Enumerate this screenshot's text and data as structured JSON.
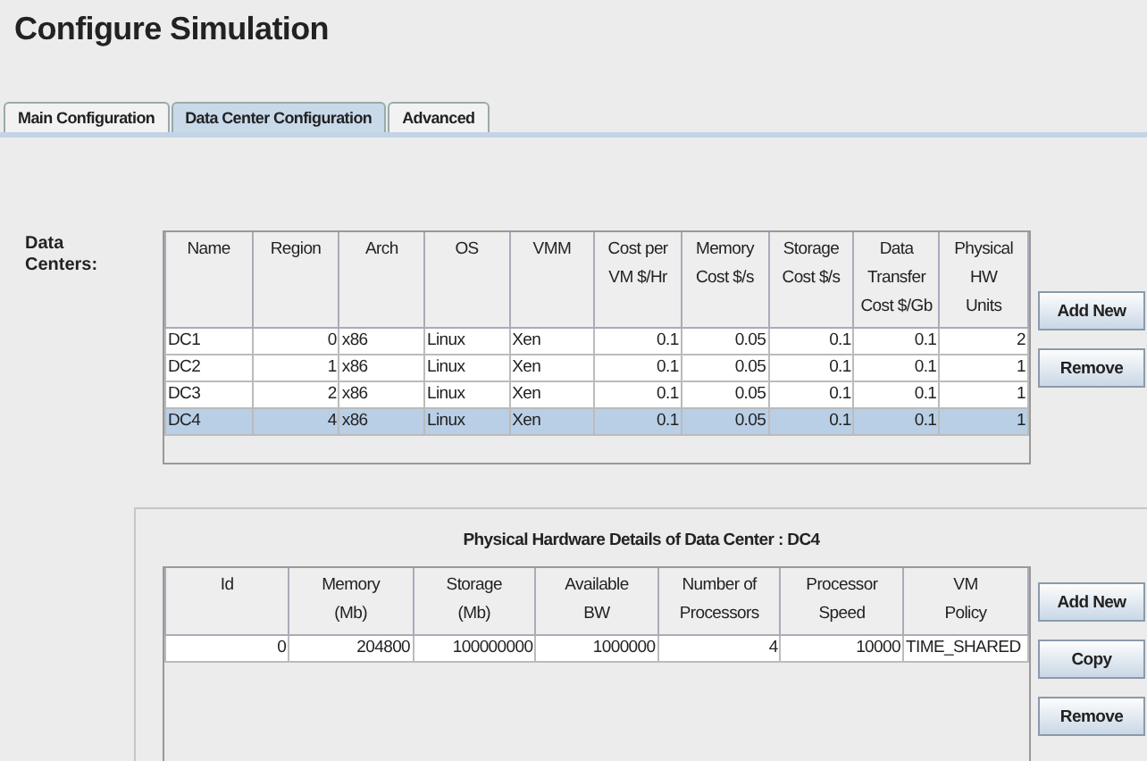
{
  "title": "Configure Simulation",
  "tabs": [
    {
      "label": "Main Configuration",
      "selected": false
    },
    {
      "label": "Data Center Configuration",
      "selected": true
    },
    {
      "label": "Advanced",
      "selected": false
    }
  ],
  "data_centers": {
    "label": "Data\nCenters:",
    "columns": [
      "Name",
      "Region",
      "Arch",
      "OS",
      "VMM",
      "Cost per\nVM $/Hr",
      "Memory\nCost $/s",
      "Storage\nCost $/s",
      "Data\nTransfer\nCost $/Gb",
      "Physical\nHW\nUnits"
    ],
    "rows": [
      {
        "cells": [
          "DC1",
          "0",
          "x86",
          "Linux",
          "Xen",
          "0.1",
          "0.05",
          "0.1",
          "0.1",
          "2"
        ],
        "selected": false
      },
      {
        "cells": [
          "DC2",
          "1",
          "x86",
          "Linux",
          "Xen",
          "0.1",
          "0.05",
          "0.1",
          "0.1",
          "1"
        ],
        "selected": false
      },
      {
        "cells": [
          "DC3",
          "2",
          "x86",
          "Linux",
          "Xen",
          "0.1",
          "0.05",
          "0.1",
          "0.1",
          "1"
        ],
        "selected": false
      },
      {
        "cells": [
          "DC4",
          "4",
          "x86",
          "Linux",
          "Xen",
          "0.1",
          "0.05",
          "0.1",
          "0.1",
          "1"
        ],
        "selected": true
      }
    ],
    "buttons": [
      "Add New",
      "Remove"
    ]
  },
  "hardware": {
    "title": "Physical Hardware Details of Data Center : DC4",
    "columns": [
      "Id",
      "Memory\n(Mb)",
      "Storage\n(Mb)",
      "Available\nBW",
      "Number of\nProcessors",
      "Processor\nSpeed",
      "VM\nPolicy"
    ],
    "rows": [
      {
        "cells": [
          "0",
          "204800",
          "100000000",
          "1000000",
          "4",
          "10000",
          "TIME_SHARED"
        ],
        "selected": false
      }
    ],
    "buttons": [
      "Add New",
      "Copy",
      "Remove"
    ]
  }
}
